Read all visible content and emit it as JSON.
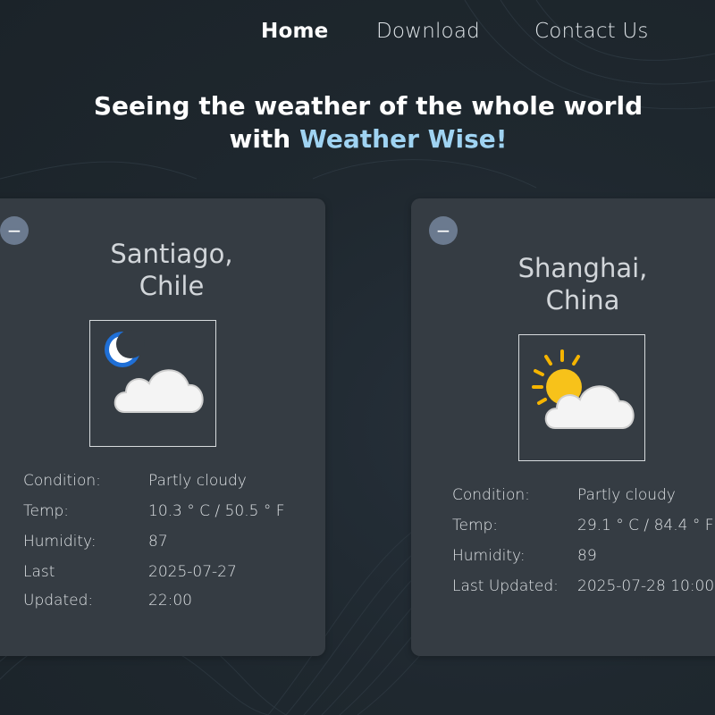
{
  "nav": {
    "home": "Home",
    "download": "Download",
    "contact": "Contact Us"
  },
  "hero": {
    "line1": "Seeing the weather of the whole world",
    "line2_prefix": "with ",
    "brand": "Weather Wise!"
  },
  "colors": {
    "accent": "#9fd3f2",
    "card_bg": "#353c43",
    "remove_button": "#6b7a8f"
  },
  "cards": [
    {
      "remove_symbol": "−",
      "city_line1": "Santiago,",
      "city_line2": "Chile",
      "icon": "moon-cloud-icon",
      "labels": {
        "condition": "Condition:",
        "temp": "Temp:",
        "humidity": "Humidity:",
        "updated_line1": "Last",
        "updated_line2": "Updated:"
      },
      "values": {
        "condition": "Partly cloudy",
        "temp": "10.3 ° C / 50.5 ° F",
        "humidity": "87",
        "updated_date": "2025-07-27",
        "updated_time": "22:00"
      }
    },
    {
      "remove_symbol": "−",
      "city_line1": "Shanghai,",
      "city_line2": "China",
      "icon": "sun-cloud-icon",
      "labels": {
        "condition": "Condition:",
        "temp": "Temp:",
        "humidity": "Humidity:",
        "updated": "Last Updated:"
      },
      "values": {
        "condition": "Partly cloudy",
        "temp": "29.1 ° C / 84.4 ° F",
        "humidity": "89",
        "updated": "2025-07-28 10:00"
      }
    }
  ]
}
